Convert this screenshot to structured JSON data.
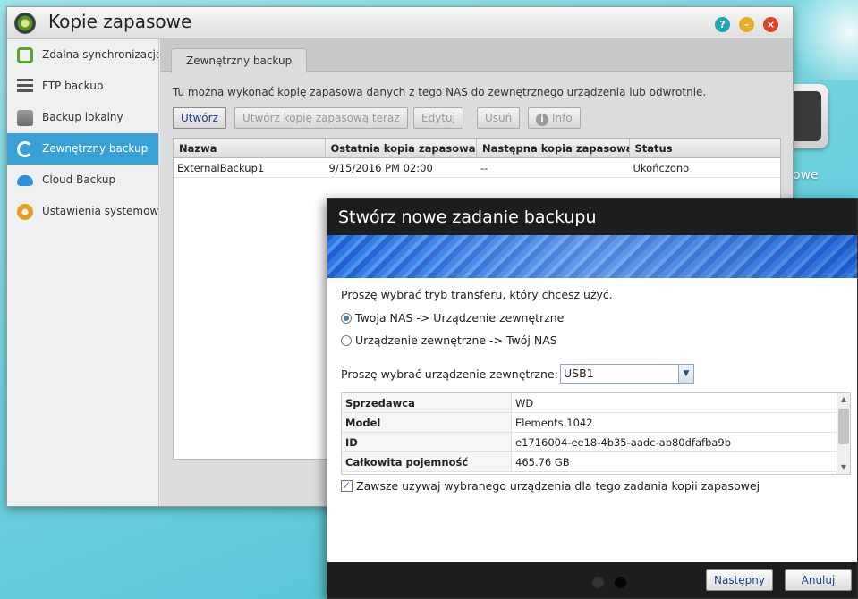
{
  "window": {
    "title": "Kopie zapasowe"
  },
  "desktop": {
    "partial_label": "owe"
  },
  "sidebar": {
    "items": [
      {
        "label": "Zdalna synchronizacja",
        "icon": "sync-icon"
      },
      {
        "label": "FTP backup",
        "icon": "ftp-icon"
      },
      {
        "label": "Backup lokalny",
        "icon": "local-drive-icon"
      },
      {
        "label": "Zewnętrzny backup",
        "icon": "external-backup-icon",
        "active": true
      },
      {
        "label": "Cloud Backup",
        "icon": "cloud-icon"
      },
      {
        "label": "Ustawienia systemowe",
        "icon": "gear-icon"
      }
    ]
  },
  "main": {
    "tab": "Zewnętrzny backup",
    "description": "Tu można wykonać kopię zapasową danych z tego NAS do zewnętrznego urządzenia lub odwrotnie.",
    "toolbar": {
      "create": "Utwórz",
      "backup_now": "Utwórz kopię zapasową teraz",
      "edit": "Edytuj",
      "delete": "Usuń",
      "info": "Info"
    },
    "table": {
      "headers": [
        "Nazwa",
        "Ostatnia kopia zapasowa",
        "Następna kopia zapasowa",
        "Status"
      ],
      "rows": [
        [
          "ExternalBackup1",
          "9/15/2016 PM 02:00",
          "--",
          "Ukończono"
        ]
      ]
    }
  },
  "dialog": {
    "title": "Stwórz nowe zadanie backupu",
    "mode_prompt": "Proszę wybrać tryb transferu, który chcesz użyć.",
    "options": [
      {
        "label": "Twoja NAS -> Urządzenie zewnętrzne",
        "selected": true
      },
      {
        "label": "Urządzenie zewnętrzne -> Twój NAS",
        "selected": false
      }
    ],
    "device_prompt": "Proszę wybrać urządzenie zewnętrzne:",
    "device_selected": "USB1",
    "device_info": [
      {
        "key": "Sprzedawca",
        "value": "WD"
      },
      {
        "key": "Model",
        "value": "Elements 1042"
      },
      {
        "key": "ID",
        "value": "e1716004-ee18-4b35-aadc-ab80dfafba9b"
      },
      {
        "key": "Całkowita pojemność",
        "value": "465.76 GB"
      }
    ],
    "always_use_label": "Zawsze używaj wybranego urządzenia dla tego zadania kopii zapasowej",
    "always_use_checked": true,
    "next": "Następny",
    "cancel": "Anuluj"
  },
  "colors": {
    "accent": "#3aa0d8",
    "titlebar_dark": "#1d1d1d",
    "help_button": "#1fa6b4",
    "minimize_button": "#e4ad2a",
    "close_button": "#d8442c"
  }
}
